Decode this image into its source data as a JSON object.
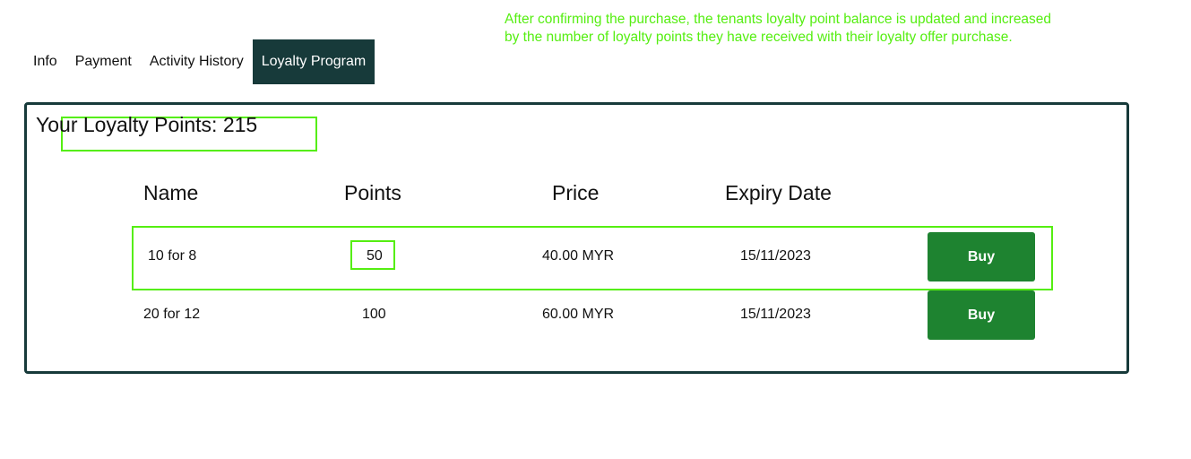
{
  "annotation": {
    "line1": "After confirming the purchase, the tenants loyalty point balance is updated and increased",
    "line2": "by the number of loyalty points they have received with their loyalty offer purchase."
  },
  "tabs": [
    {
      "label": "Info",
      "active": false
    },
    {
      "label": "Payment",
      "active": false
    },
    {
      "label": "Activity History",
      "active": false
    },
    {
      "label": "Loyalty Program",
      "active": true
    }
  ],
  "loyalty": {
    "points_label": "Your Loyalty Points: 215"
  },
  "table": {
    "headers": {
      "name": "Name",
      "points": "Points",
      "price": "Price",
      "expiry": "Expiry Date"
    },
    "rows": [
      {
        "name": "10 for 8",
        "points": "50",
        "price": "40.00 MYR",
        "expiry": "15/11/2023",
        "action": "Buy"
      },
      {
        "name": "20 for 12",
        "points": "100",
        "price": "60.00 MYR",
        "expiry": "15/11/2023",
        "action": "Buy"
      }
    ]
  },
  "colors": {
    "accent_dark": "#173a3a",
    "button_green": "#1e8330",
    "annotation_green": "#55ee11"
  }
}
